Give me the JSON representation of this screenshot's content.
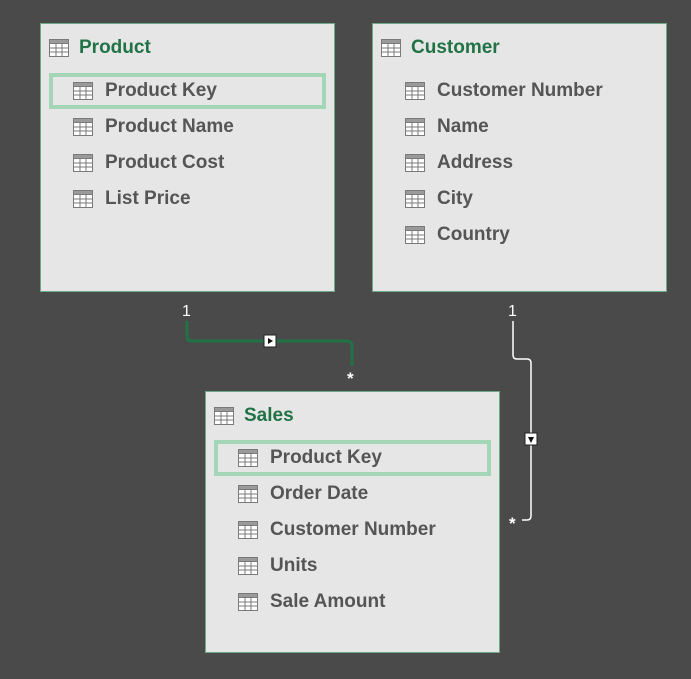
{
  "tables": {
    "product": {
      "title": "Product",
      "fields": [
        "Product Key",
        "Product Name",
        "Product Cost",
        "List Price"
      ],
      "selected_field": "Product Key"
    },
    "customer": {
      "title": "Customer",
      "fields": [
        "Customer Number",
        "Name",
        "Address",
        "City",
        "Country"
      ]
    },
    "sales": {
      "title": "Sales",
      "fields": [
        "Product Key",
        "Order Date",
        "Customer Number",
        "Units",
        "Sale Amount"
      ],
      "selected_field": "Product Key"
    }
  },
  "relationships": {
    "product_sales": {
      "one_label": "1",
      "many_label": "*",
      "active": true,
      "color": "#217346"
    },
    "customer_sales": {
      "one_label": "1",
      "many_label": "*",
      "active": true,
      "color": "#ffffff"
    }
  },
  "colors": {
    "background": "#4a4a4a",
    "card": "#e6e6e6",
    "card_border": "#6fa886",
    "title": "#217346",
    "field_text": "#555555",
    "selection": "#a3d6b7"
  },
  "icons": {
    "table": "table-icon",
    "column": "column-icon",
    "arrow": "filter-arrow-icon"
  }
}
